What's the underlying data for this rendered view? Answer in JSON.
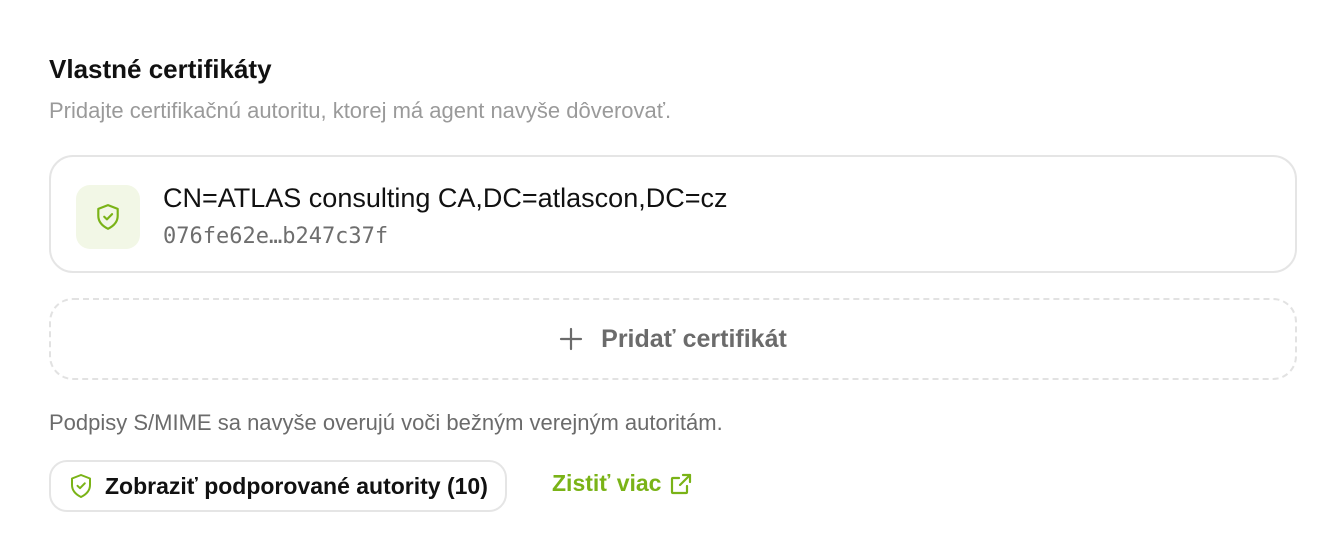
{
  "section": {
    "title": "Vlastné certifikáty",
    "subtitle": "Pridajte certifikačnú autoritu, ktorej má agent navyše dôverovať."
  },
  "certificates": [
    {
      "name": "CN=ATLAS consulting CA,DC=atlascon,DC=cz",
      "fingerprint": "076fe62e…b247c37f",
      "icon": "shield-check-icon"
    }
  ],
  "add_certificate": {
    "label": "Pridať certifikát",
    "icon": "plus-icon"
  },
  "info_text": "Podpisy S/MIME sa navyše overujú voči bežným verejným autoritám.",
  "authorities_button": {
    "label": "Zobraziť podporované autority (10)",
    "icon": "shield-check-icon"
  },
  "learn_more": {
    "label": "Zistiť viac",
    "icon": "external-link-icon"
  },
  "colors": {
    "accent": "#7ab317",
    "icon_bg": "#f2f7e6",
    "muted_text": "#9a9a9a",
    "border": "#e5e5e5"
  }
}
